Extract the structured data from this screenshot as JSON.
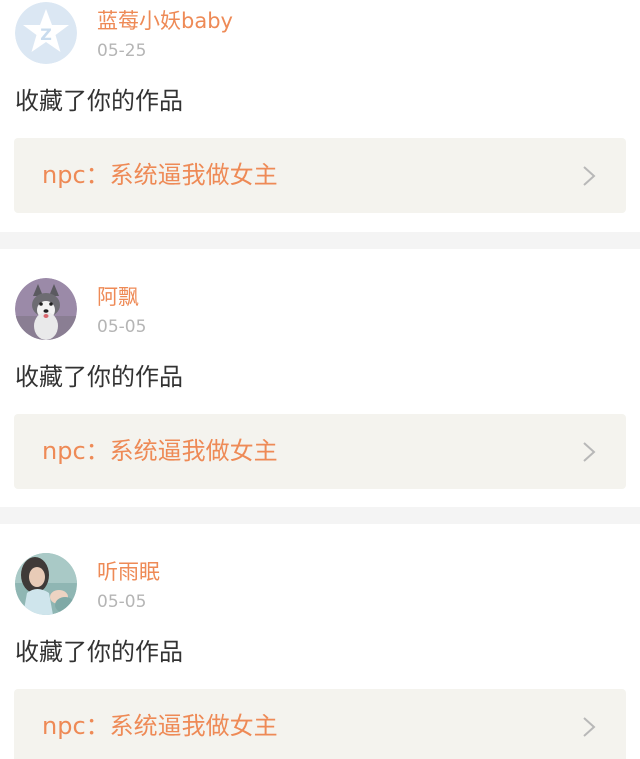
{
  "notifications": [
    {
      "username": "蓝莓小妖baby",
      "date": "05-25",
      "action": "收藏了你的作品",
      "work_title": "npc：系统逼我做女主",
      "avatar": "default-avatar-icon"
    },
    {
      "username": "阿飘",
      "date": "05-05",
      "action": "收藏了你的作品",
      "work_title": "npc：系统逼我做女主",
      "avatar": "husky-dog-photo"
    },
    {
      "username": "听雨眠",
      "date": "05-05",
      "action": "收藏了你的作品",
      "work_title": "npc：系统逼我做女主",
      "avatar": "girl-photo"
    }
  ],
  "colors": {
    "accent": "#ee8a56",
    "date_gray": "#b5b5b5",
    "card_bg": "#f4f3ee",
    "separator": "#f4f4f4"
  }
}
